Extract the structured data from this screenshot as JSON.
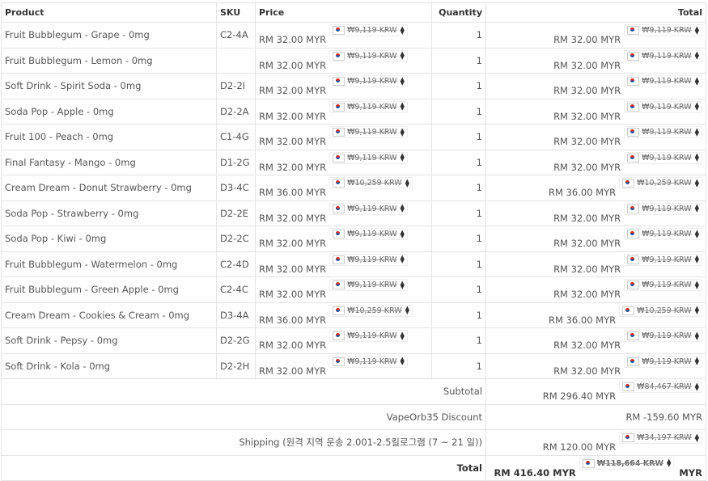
{
  "headers": {
    "product": "Product",
    "sku": "SKU",
    "price": "Price",
    "quantity": "Quantity",
    "total": "Total"
  },
  "rows": [
    {
      "product": "Fruit Bubblegum - Grape - 0mg",
      "sku": "C2-4A",
      "price": "RM 32.00 MYR",
      "price_krw": "₩9,119 KRW",
      "qty": "1",
      "total": "RM 32.00 MYR",
      "total_krw": "₩9,119 KRW"
    },
    {
      "product": "Fruit Bubblegum - Lemon - 0mg",
      "sku": "",
      "price": "RM 32.00 MYR",
      "price_krw": "₩9,119 KRW",
      "qty": "1",
      "total": "RM 32.00 MYR",
      "total_krw": "₩9,119 KRW"
    },
    {
      "product": "Soft Drink - Spirit Soda - 0mg",
      "sku": "D2-2I",
      "price": "RM 32.00 MYR",
      "price_krw": "₩9,119 KRW",
      "qty": "1",
      "total": "RM 32.00 MYR",
      "total_krw": "₩9,119 KRW"
    },
    {
      "product": "Soda Pop - Apple - 0mg",
      "sku": "D2-2A",
      "price": "RM 32.00 MYR",
      "price_krw": "₩9,119 KRW",
      "qty": "1",
      "total": "RM 32.00 MYR",
      "total_krw": "₩9,119 KRW"
    },
    {
      "product": "Fruit 100 - Peach - 0mg",
      "sku": "C1-4G",
      "price": "RM 32.00 MYR",
      "price_krw": "₩9,119 KRW",
      "qty": "1",
      "total": "RM 32.00 MYR",
      "total_krw": "₩9,119 KRW"
    },
    {
      "product": "Final Fantasy - Mango - 0mg",
      "sku": "D1-2G",
      "price": "RM 32.00 MYR",
      "price_krw": "₩9,119 KRW",
      "qty": "1",
      "total": "RM 32.00 MYR",
      "total_krw": "₩9,119 KRW"
    },
    {
      "product": "Cream Dream - Donut Strawberry - 0mg",
      "sku": "D3-4C",
      "price": "RM 36.00 MYR",
      "price_krw": "₩10,259 KRW",
      "qty": "1",
      "total": "RM 36.00 MYR",
      "total_krw": "₩10,259 KRW"
    },
    {
      "product": "Soda Pop - Strawberry - 0mg",
      "sku": "D2-2E",
      "price": "RM 32.00 MYR",
      "price_krw": "₩9,119 KRW",
      "qty": "1",
      "total": "RM 32.00 MYR",
      "total_krw": "₩9,119 KRW"
    },
    {
      "product": "Soda Pop - Kiwi - 0mg",
      "sku": "D2-2C",
      "price": "RM 32.00 MYR",
      "price_krw": "₩9,119 KRW",
      "qty": "1",
      "total": "RM 32.00 MYR",
      "total_krw": "₩9,119 KRW"
    },
    {
      "product": "Fruit Bubblegum - Watermelon - 0mg",
      "sku": "C2-4D",
      "price": "RM 32.00 MYR",
      "price_krw": "₩9,119 KRW",
      "qty": "1",
      "total": "RM 32.00 MYR",
      "total_krw": "₩9,119 KRW"
    },
    {
      "product": "Fruit Bubblegum - Green Apple - 0mg",
      "sku": "C2-4C",
      "price": "RM 32.00 MYR",
      "price_krw": "₩9,119 KRW",
      "qty": "1",
      "total": "RM 32.00 MYR",
      "total_krw": "₩9,119 KRW"
    },
    {
      "product": "Cream Dream - Cookies & Cream - 0mg",
      "sku": "D3-4A",
      "price": "RM 36.00 MYR",
      "price_krw": "₩10,259 KRW",
      "qty": "1",
      "total": "RM 36.00 MYR",
      "total_krw": "₩10,259 KRW"
    },
    {
      "product": "Soft Drink - Pepsy - 0mg",
      "sku": "D2-2G",
      "price": "RM 32.00 MYR",
      "price_krw": "₩9,119 KRW",
      "qty": "1",
      "total": "RM 32.00 MYR",
      "total_krw": "₩9,119 KRW"
    },
    {
      "product": "Soft Drink - Kola - 0mg",
      "sku": "D2-2H",
      "price": "RM 32.00 MYR",
      "price_krw": "₩9,119 KRW",
      "qty": "1",
      "total": "RM 32.00 MYR",
      "total_krw": "₩9,119 KRW"
    }
  ],
  "summary": {
    "subtotal_label": "Subtotal",
    "subtotal_value": "RM 296.40 MYR",
    "subtotal_krw": "₩84,467 KRW",
    "discount_label": "VapeOrb35 Discount",
    "discount_value": "RM -159.60 MYR",
    "shipping_label": "Shipping (원격 지역 운송 2.001-2.5킬로그램 (7 ~ 21 일))",
    "shipping_value": "RM 120.00 MYR",
    "shipping_krw": "₩34,197 KRW",
    "total_label": "Total",
    "total_value": "RM 416.40 MYR",
    "total_krw": "₩118,664 KRW",
    "total_suffix": "MYR"
  },
  "icons": {
    "flag": "korea-flag-icon",
    "sort": "up-down-arrow-icon"
  }
}
